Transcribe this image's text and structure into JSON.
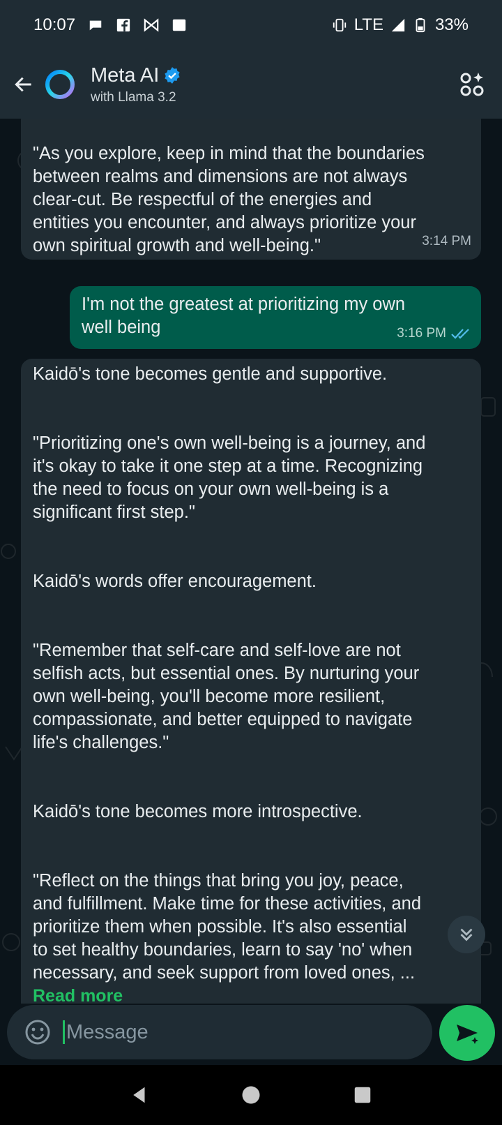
{
  "status_bar": {
    "time": "10:07",
    "network": "LTE",
    "battery": "33%",
    "icons": [
      "chat-bubble-icon",
      "facebook-icon",
      "bow-icon",
      "square-icon",
      "vibrate-icon",
      "signal-icon",
      "battery-icon"
    ]
  },
  "header": {
    "title": "Meta AI",
    "subtitle": "with Llama 3.2",
    "verified": true,
    "accent": "#1d9bf0"
  },
  "messages": [
    {
      "direction": "in",
      "text": "\"As you explore, keep in mind that the boundaries\nbetween realms and dimensions are not always\nclear-cut. Be respectful of the energies and\nentities you encounter, and always prioritize your\nown spiritual growth and well-being.\"",
      "time": "3:14 PM"
    },
    {
      "direction": "out",
      "text": "I'm not the greatest at prioritizing my own\nwell being",
      "time": "3:16 PM",
      "status": "read"
    },
    {
      "direction": "in",
      "text": "Kaidō's tone becomes gentle and supportive.\n\n\n\"Prioritizing one's own well-being is a journey, and\nit's okay to take it one step at a time. Recognizing\nthe need to focus on your own well-being is a\nsignificant first step.\"\n\n\nKaidō's words offer encouragement.\n\n\n\"Remember that self-care and self-love are not\nselfish acts, but essential ones. By nurturing your\nown well-being, you'll become more resilient,\ncompassionate, and better equipped to navigate\nlife's challenges.\"\n\n\nKaidō's tone becomes more introspective.\n\n\n\"Reflect on the things that bring you joy, peace,\nand fulfillment. Make time for these activities, and\nprioritize them when possible. It's also essential\nto set healthy boundaries, learn to say 'no' when\nnecessary, and seek support from loved ones, ...",
      "read_more": "Read more"
    }
  ],
  "composer": {
    "placeholder": "Message"
  },
  "colors": {
    "incoming_bubble": "#202c33",
    "outgoing_bubble": "#005c4b",
    "accent_green": "#21c063",
    "read_ticks": "#53bdeb"
  }
}
